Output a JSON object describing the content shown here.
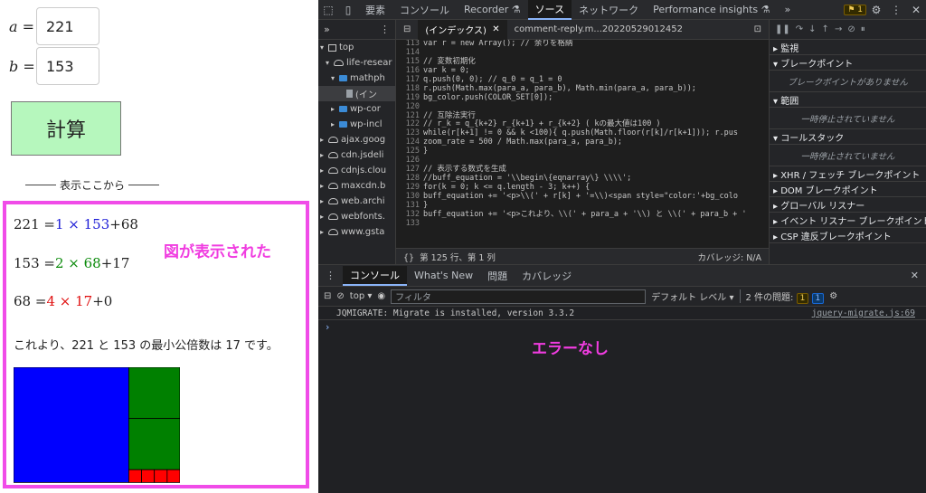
{
  "left": {
    "a_label": "a =",
    "a_value": "221",
    "b_label": "b =",
    "b_value": "153",
    "calc_label": "計算",
    "divider_text": "表示ここから",
    "equations": [
      {
        "pre": "221 =",
        "q": "1",
        "times": " × ",
        "d": "153",
        "post": "+68"
      },
      {
        "pre": "153 =",
        "q": "2",
        "times": " × ",
        "d": "68",
        "post": "+17"
      },
      {
        "pre": "68 =",
        "q": "4",
        "times": " × ",
        "d": "17",
        "post": "+0"
      }
    ],
    "annotation": "図が表示された",
    "conclusion": "これより、221 と 153 の最小公倍数は 17 です。",
    "colors": {
      "blue": "#0000ff",
      "green": "#008000",
      "red": "#ff0000",
      "border": "#f04ce8"
    },
    "figure": {
      "a": 221,
      "b": 153,
      "squares": [
        {
          "side": 153,
          "count": 1,
          "color": "#0000ff"
        },
        {
          "side": 68,
          "count": 2,
          "color": "#008000"
        },
        {
          "side": 17,
          "count": 4,
          "color": "#ff0000"
        }
      ]
    }
  },
  "devtools": {
    "top_tabs": [
      "要素",
      "コンソール",
      "Recorder ⚗",
      "ソース",
      "ネットワーク",
      "Performance insights ⚗",
      "»"
    ],
    "active_tab": "ソース",
    "issues_badge": "1",
    "nav": {
      "items": [
        "top",
        "life-resear",
        "mathph",
        "(イン",
        "wp-cor",
        "wp-incl",
        "ajax.goog",
        "cdn.jsdeli",
        "cdnjs.clou",
        "maxcdn.b",
        "web.archi",
        "webfonts.",
        "www.gsta"
      ]
    },
    "editor": {
      "tabs": [
        "(インデックス)",
        "comment-reply.m...20220529012452"
      ],
      "lines": [
        {
          "n": "113",
          "t": "var r = new Array(); // 余りを格納"
        },
        {
          "n": "114",
          "t": ""
        },
        {
          "n": "115",
          "t": "// 変数初期化"
        },
        {
          "n": "116",
          "t": "var k = 0;"
        },
        {
          "n": "117",
          "t": "q.push(0, 0); // q_0 = q_1 = 0"
        },
        {
          "n": "118",
          "t": "r.push(Math.max(para_a, para_b), Math.min(para_a, para_b));"
        },
        {
          "n": "119",
          "t": "bg_color.push(COLOR_SET[0]);"
        },
        {
          "n": "120",
          "t": ""
        },
        {
          "n": "121",
          "t": "// 互除法実行"
        },
        {
          "n": "122",
          "t": "// r_k = q_{k+2} r_{k+1} + r_{k+2} ( kの最大値は100 )"
        },
        {
          "n": "123",
          "t": "while(r[k+1] != 0 && k <100){ q.push(Math.floor(r[k]/r[k+1])); r.pus"
        },
        {
          "n": "124",
          "t": "zoom_rate = 500 / Math.max(para_a, para_b);"
        },
        {
          "n": "125",
          "t": "}"
        },
        {
          "n": "126",
          "t": ""
        },
        {
          "n": "127",
          "t": "// 表示する数式を生成"
        },
        {
          "n": "128",
          "t": "//buff_equation = '\\\\begin\\{eqnarray\\} \\\\\\\\';"
        },
        {
          "n": "129",
          "t": "for(k = 0; k <= q.length - 3; k++) {"
        },
        {
          "n": "130",
          "t": "buff_equation += '<p>\\\\(' + r[k] + '=\\\\)<span style=\"color:'+bg_colo"
        },
        {
          "n": "131",
          "t": "}"
        },
        {
          "n": "132",
          "t": "buff_equation += '<p>これより、\\\\(' + para_a + '\\\\) と \\\\(' + para_b + '"
        },
        {
          "n": "133",
          "t": ""
        }
      ],
      "status_pos": "第 125 行、第 1 列",
      "status_cov": "カバレッジ: N/A"
    },
    "debugger": {
      "sections": [
        {
          "title": "▸ 監視",
          "body": ""
        },
        {
          "title": "▾ ブレークポイント",
          "body": "ブレークポイントがありません"
        },
        {
          "title": "▾ 範囲",
          "body": "一時停止されていません"
        },
        {
          "title": "▾ コールスタック",
          "body": "一時停止されていません"
        },
        {
          "title": "▸ XHR / フェッチ ブレークポイント",
          "body": ""
        },
        {
          "title": "▸ DOM ブレークポイント",
          "body": ""
        },
        {
          "title": "▸ グローバル リスナー",
          "body": ""
        },
        {
          "title": "▸ イベント リスナー ブレークポイント",
          "body": ""
        },
        {
          "title": "▸ CSP 違反ブレークポイント",
          "body": ""
        }
      ]
    },
    "console": {
      "tabs": [
        "コンソール",
        "What's New",
        "問題",
        "カバレッジ"
      ],
      "context": "top ▾",
      "filter_placeholder": "フィルタ",
      "level": "デフォルト レベル ▾",
      "issues": "2 件の問題:",
      "issues_warn": "1",
      "issues_info": "1",
      "messages": [
        {
          "text": "JQMIGRATE: Migrate is installed, version 3.3.2",
          "source": "jquery-migrate.js:69"
        }
      ],
      "prompt": "›",
      "annotation": "エラーなし"
    }
  }
}
